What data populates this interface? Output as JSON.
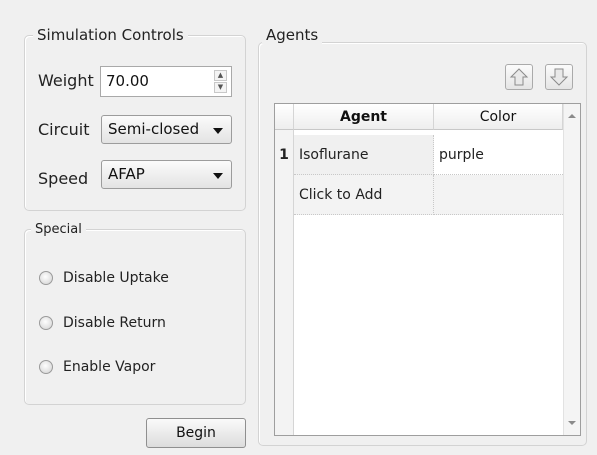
{
  "simulation_controls": {
    "title": "Simulation Controls",
    "weight_label": "Weight",
    "weight_value": "70.00",
    "circuit_label": "Circuit",
    "circuit_value": "Semi-closed",
    "speed_label": "Speed",
    "speed_value": "AFAP"
  },
  "special": {
    "title": "Special",
    "options": [
      {
        "label": "Disable Uptake",
        "checked": false
      },
      {
        "label": "Disable Return",
        "checked": false
      },
      {
        "label": "Enable Vapor",
        "checked": false
      }
    ]
  },
  "begin_button": "Begin",
  "agents": {
    "title": "Agents",
    "columns": [
      "Agent",
      "Color"
    ],
    "rows": [
      {
        "index": "1",
        "agent": "Isoflurane",
        "color": "purple"
      },
      {
        "index": "",
        "agent": "Click to Add",
        "color": ""
      }
    ]
  },
  "icons": {
    "move_up": "arrow-up-icon",
    "move_down": "arrow-down-icon",
    "spin_up": "triangle-up-icon",
    "spin_down": "triangle-down-icon",
    "scroll_up": "triangle-up-icon",
    "scroll_down": "triangle-down-icon"
  }
}
